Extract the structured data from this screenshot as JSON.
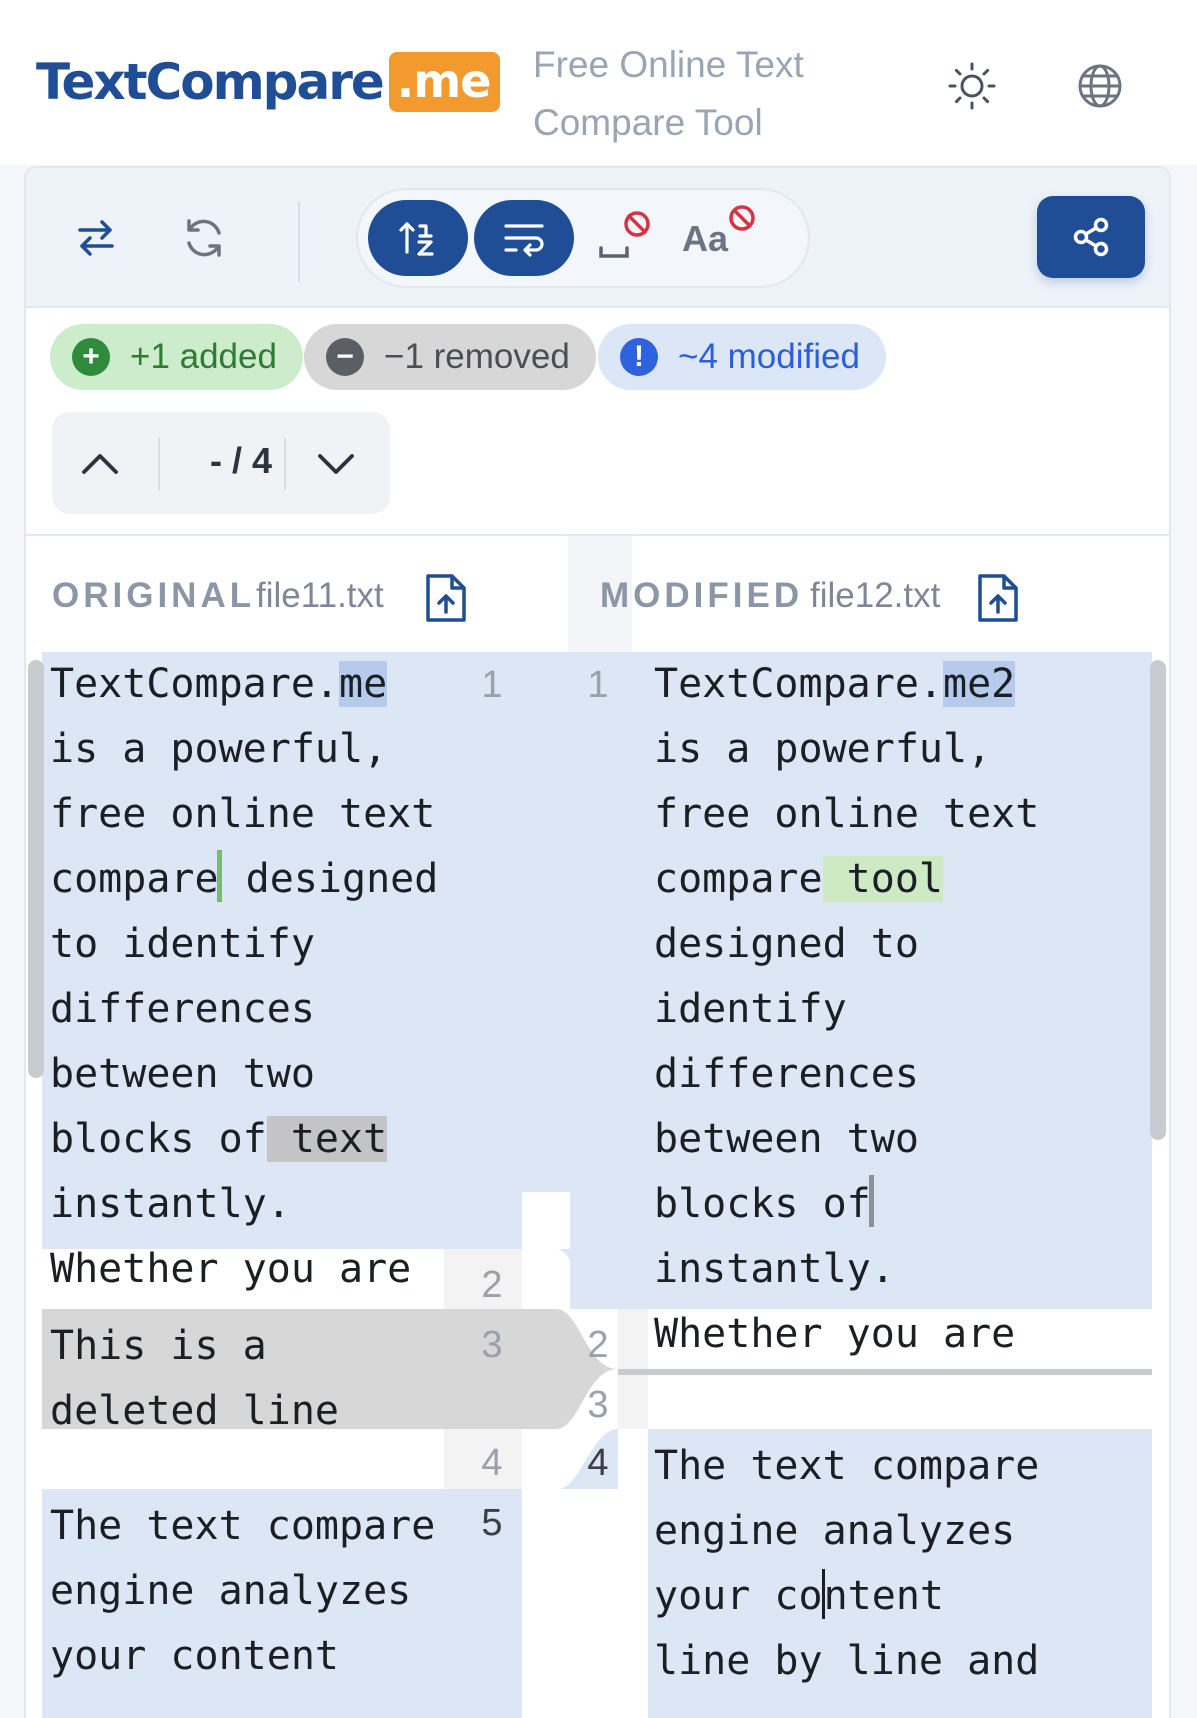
{
  "header": {
    "logo_main": "TextCompare",
    "logo_badge": ".me",
    "tagline": "Free Online Text Compare Tool",
    "theme_icon": "sun-icon",
    "language_icon": "globe-icon"
  },
  "toolbar": {
    "swap_icon": "swap-arrows-icon",
    "refresh_icon": "refresh-icon",
    "sync_scroll_icon": "sort-lines-icon",
    "wrap_icon": "wrap-text-icon",
    "ignore_whitespace_icon": "whitespace-off-icon",
    "ignore_case_label": "Aa",
    "share_icon": "share-icon"
  },
  "stats": {
    "added": "+1 added",
    "removed": "−1 removed",
    "modified": "~4 modified"
  },
  "navigator": {
    "counter": "- / 4"
  },
  "original": {
    "label": "ORIGINAL",
    "file": "file11.txt"
  },
  "modified": {
    "label": "MODIFIED",
    "file": "file12.txt"
  },
  "left_lines": {
    "l1": "1",
    "l2": "2",
    "l3": "3",
    "l4": "4",
    "l5": "5"
  },
  "right_lines": {
    "l1": "1",
    "l2": "2",
    "l3": "3",
    "l4": "4"
  },
  "left_text": {
    "r1a": "TextCompare.",
    "r1b": "me",
    "r2": "is a powerful,",
    "r3": "free online text",
    "r4a": "compare",
    "r4b": " designed",
    "r5": "to identify",
    "r6": "differences",
    "r7": "between two",
    "r8a": "blocks of",
    "r8b": " text",
    "r9": "instantly.",
    "r10": "Whether you are",
    "del1": "This is a",
    "del2": "deleted line",
    "b5a": "The text compare",
    "b5b": "engine analyzes",
    "b5c": "your content"
  },
  "right_text": {
    "r1a": "TextCompare.",
    "r1b": "me2",
    "r2": "is a powerful,",
    "r3": "free online text",
    "r4a": "compare",
    "r4b": " tool",
    "r5": "designed to",
    "r6": "identify",
    "r7": "differences",
    "r8": "between two",
    "r9": "blocks of",
    "r10": "instantly.",
    "r11": "Whether you are",
    "b4a": "The text compare",
    "b4b": "engine analyzes",
    "b4c1": "your co",
    "b4c2": "ntent",
    "b4d": "line by line and"
  },
  "colors": {
    "brand": "#1f4e96",
    "badge_orange": "#f29a2e",
    "modified_bg": "#dce6f5",
    "removed_bg": "#d7d7d8",
    "added_bg": "#cdeac5"
  }
}
